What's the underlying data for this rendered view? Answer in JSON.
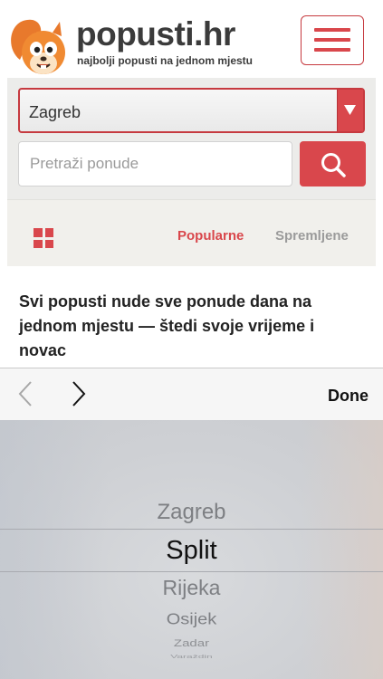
{
  "header": {
    "brand": "popusti.hr",
    "tagline": "najbolji popusti na jednom mjestu",
    "logo_icon": "squirrel-mascot-icon",
    "menu_icon": "hamburger-menu-icon"
  },
  "search": {
    "city_value": "Zagreb",
    "placeholder": "Pretraži ponude",
    "button_icon": "search-icon"
  },
  "tabs": {
    "grid_icon": "grid-view-icon",
    "popular": "Popularne",
    "saved": "Spremljene"
  },
  "intro": "Svi popusti nude sve ponude dana na jednom mjestu — štedi svoje vrijeme i novac",
  "keyboard_toolbar": {
    "prev_icon": "chevron-left-icon",
    "next_icon": "chevron-right-icon",
    "done": "Done"
  },
  "picker": {
    "options": [
      "Zagreb",
      "Split",
      "Rijeka",
      "Osijek",
      "Zadar",
      "Varaždin"
    ],
    "selected": "Split"
  },
  "colors": {
    "accent": "#d9474c",
    "text": "#222222",
    "muted": "#9b9b9b",
    "panel": "#ececea"
  }
}
